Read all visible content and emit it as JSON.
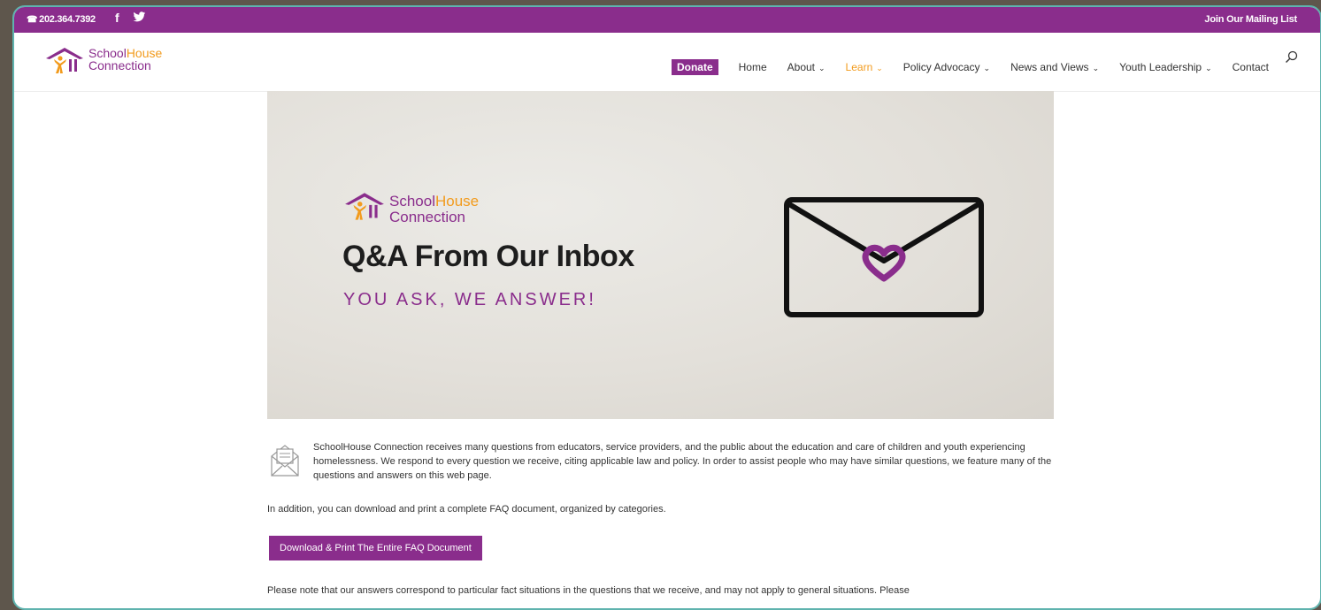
{
  "topbar": {
    "phone": "202.364.7392",
    "facebook_icon": "f",
    "mailing_list": "Join Our Mailing List"
  },
  "header": {
    "logo": {
      "school": "School",
      "house": "House",
      "connection": "Connection"
    },
    "nav": [
      {
        "label": "Donate",
        "type": "donate"
      },
      {
        "label": "Home"
      },
      {
        "label": "About",
        "chevron": true
      },
      {
        "label": "Learn",
        "chevron": true,
        "active": true
      },
      {
        "label": "Policy Advocacy",
        "chevron": true
      },
      {
        "label": "News and Views",
        "chevron": true
      },
      {
        "label": "Youth Leadership",
        "chevron": true
      },
      {
        "label": "Contact"
      }
    ]
  },
  "hero": {
    "logo": {
      "school": "School",
      "house": "House",
      "connection": "Connection"
    },
    "title": "Q&A From Our Inbox",
    "subtitle": "YOU ASK, WE ANSWER!"
  },
  "content": {
    "intro": "SchoolHouse Connection receives many questions from educators, service providers, and the public about the education and care of children and youth experiencing homelessness. We respond to every question we receive, citing applicable law and policy. In order to assist people who may have similar questions, we feature many of the questions and answers on this web page.",
    "download_note": "In addition, you can download and print a complete FAQ document, organized by categories.",
    "download_button": "Download & Print The Entire FAQ Document",
    "disclaimer": "Please note that our answers correspond to particular fact situations in the questions that we receive, and may not apply to general situations. Please"
  },
  "colors": {
    "brand": "#8a2d8c",
    "accent": "#f29b1d",
    "frame": "#5fb3ae"
  }
}
